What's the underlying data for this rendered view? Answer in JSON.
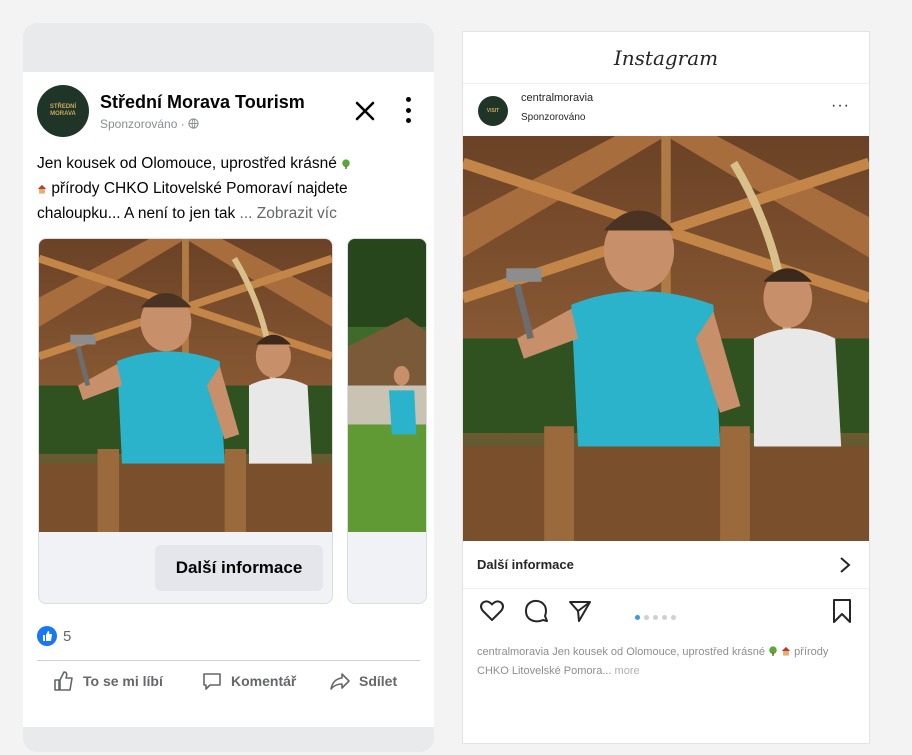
{
  "facebook": {
    "avatar_text": "STŘEDNÍ MORAVA",
    "page_name": "Střední Morava Tourism",
    "sponsored": "Sponzorováno · ",
    "post_text_1": "Jen kousek od Olomouce, uprostřed krásné ",
    "post_text_2": " přírody CHKO Litovelské Pomoraví najdete chaloupku... A není to jen tak",
    "see_more": "... Zobrazit víc",
    "cta_label": "Další informace",
    "reactions_count": "5",
    "actions": {
      "like": "To se mi líbí",
      "comment": "Komentář",
      "share": "Sdílet"
    },
    "icons": [
      "close-icon",
      "more-vertical-icon",
      "globe-icon",
      "like-icon",
      "comment-icon",
      "share-icon"
    ]
  },
  "instagram": {
    "logo": "Instagram",
    "avatar_text": "VISIT",
    "username": "centralmoravia",
    "sponsored": "Sponzorováno",
    "more_label": "···",
    "cta_label": "Další informace",
    "carousel_total": 5,
    "carousel_active": 1,
    "caption_user": "centralmoravia",
    "caption_text_1": " Jen kousek od Olomouce, uprostřed krásné ",
    "caption_text_2": " přírody CHKO Litovelské Pomora...",
    "caption_more": " more",
    "icons": [
      "heart-icon",
      "comment-icon",
      "share-icon",
      "bookmark-icon",
      "chevron-right-icon"
    ]
  },
  "colors": {
    "fb_blue": "#1877f2",
    "ig_dot_active": "#3897f0"
  }
}
